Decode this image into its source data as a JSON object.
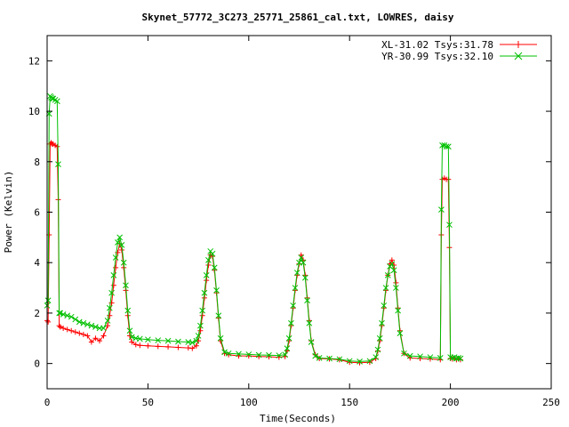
{
  "chart_data": {
    "type": "line",
    "title": "Skynet_57772_3C273_25771_25861_cal.txt, LOWRES, daisy",
    "xlabel": "Time(Seconds)",
    "ylabel": "Power (Kelvin)",
    "xlim": [
      0,
      250
    ],
    "ylim": [
      -1,
      13
    ],
    "x_ticks": [
      0,
      50,
      100,
      150,
      200,
      250
    ],
    "y_ticks": [
      0,
      2,
      4,
      6,
      8,
      10,
      12
    ],
    "x_tick_labels": [
      "0",
      "50",
      "100",
      "150",
      "200",
      "250"
    ],
    "y_tick_labels": [
      "0",
      "2",
      "4",
      "6",
      "8",
      "10",
      "12"
    ],
    "grid": false,
    "legend_position": "top-right",
    "series": [
      {
        "name": "XL-31.02 Tsys:31.78",
        "color": "#ff0000",
        "marker": "plus",
        "x": [
          0,
          0.5,
          1,
          1.5,
          2,
          2.5,
          3,
          4,
          5,
          5.5,
          6,
          6.5,
          8,
          10,
          12,
          14,
          16,
          18,
          20,
          22,
          24,
          26,
          28,
          30,
          31,
          32,
          33,
          34,
          35,
          36,
          37,
          38,
          39,
          40,
          41,
          42,
          44,
          46,
          50,
          55,
          60,
          65,
          70,
          72,
          74,
          75,
          76,
          77,
          78,
          79,
          80,
          81,
          82,
          83,
          84,
          85,
          86,
          88,
          90,
          95,
          100,
          105,
          110,
          115,
          118,
          119,
          120,
          121,
          122,
          123,
          124,
          125,
          126,
          127,
          128,
          129,
          130,
          131,
          133,
          135,
          140,
          145,
          150,
          155,
          160,
          163,
          164,
          165,
          166,
          167,
          168,
          169,
          170,
          171,
          172,
          173,
          174,
          175,
          177,
          180,
          185,
          190,
          195,
          195.5,
          196,
          197,
          198,
          199,
          199.5,
          200,
          201,
          202,
          203,
          204,
          205
        ],
        "y": [
          1.7,
          1.65,
          5.1,
          8.7,
          8.75,
          8.7,
          8.7,
          8.65,
          8.6,
          6.5,
          1.5,
          1.45,
          1.4,
          1.35,
          1.3,
          1.25,
          1.2,
          1.15,
          1.1,
          0.85,
          1.0,
          0.9,
          1.1,
          1.5,
          1.9,
          2.4,
          3.1,
          3.8,
          4.4,
          4.75,
          4.5,
          3.8,
          2.9,
          1.9,
          1.1,
          0.85,
          0.75,
          0.72,
          0.7,
          0.68,
          0.66,
          0.64,
          0.62,
          0.6,
          0.7,
          0.9,
          1.3,
          1.9,
          2.6,
          3.3,
          3.9,
          4.3,
          4.25,
          3.7,
          2.8,
          1.8,
          0.9,
          0.4,
          0.35,
          0.3,
          0.3,
          0.28,
          0.27,
          0.25,
          0.28,
          0.5,
          0.9,
          1.5,
          2.2,
          2.9,
          3.5,
          3.95,
          4.3,
          4.1,
          3.5,
          2.6,
          1.7,
          0.9,
          0.35,
          0.2,
          0.18,
          0.15,
          0.05,
          0.03,
          0.05,
          0.2,
          0.5,
          0.9,
          1.5,
          2.2,
          2.9,
          3.5,
          3.95,
          4.1,
          3.9,
          3.2,
          2.2,
          1.3,
          0.4,
          0.22,
          0.2,
          0.18,
          0.15,
          5.1,
          7.3,
          7.35,
          7.3,
          7.3,
          4.6,
          0.2,
          0.18,
          0.2,
          0.15,
          0.18,
          0.15
        ]
      },
      {
        "name": "YR-30.99 Tsys:32.10",
        "color": "#00c000",
        "marker": "cross",
        "x": [
          0,
          0.5,
          1,
          1.5,
          2,
          2.5,
          3,
          4,
          5,
          5.5,
          6,
          6.5,
          8,
          10,
          12,
          14,
          16,
          18,
          20,
          22,
          24,
          26,
          28,
          30,
          31,
          32,
          33,
          34,
          35,
          36,
          37,
          38,
          39,
          40,
          41,
          42,
          44,
          46,
          50,
          55,
          60,
          65,
          70,
          72,
          74,
          75,
          76,
          77,
          78,
          79,
          80,
          81,
          82,
          83,
          84,
          85,
          86,
          88,
          90,
          95,
          100,
          105,
          110,
          115,
          118,
          119,
          120,
          121,
          122,
          123,
          124,
          125,
          126,
          127,
          128,
          129,
          130,
          131,
          133,
          135,
          140,
          145,
          150,
          155,
          160,
          163,
          164,
          165,
          166,
          167,
          168,
          169,
          170,
          171,
          172,
          173,
          174,
          175,
          177,
          180,
          185,
          190,
          195,
          195.5,
          196,
          197,
          198,
          199,
          199.5,
          200,
          201,
          202,
          203,
          204,
          205
        ],
        "y": [
          2.3,
          2.5,
          9.9,
          10.6,
          10.55,
          10.5,
          10.5,
          10.45,
          10.4,
          7.9,
          2.0,
          2.0,
          1.95,
          1.9,
          1.85,
          1.75,
          1.65,
          1.6,
          1.55,
          1.5,
          1.45,
          1.4,
          1.4,
          1.7,
          2.2,
          2.8,
          3.5,
          4.2,
          4.8,
          5.0,
          4.7,
          4.0,
          3.1,
          2.1,
          1.3,
          1.05,
          1.0,
          0.98,
          0.95,
          0.92,
          0.9,
          0.87,
          0.85,
          0.83,
          0.9,
          1.1,
          1.5,
          2.1,
          2.8,
          3.5,
          4.1,
          4.45,
          4.35,
          3.8,
          2.9,
          1.9,
          1.0,
          0.45,
          0.4,
          0.38,
          0.36,
          0.34,
          0.33,
          0.32,
          0.35,
          0.6,
          1.0,
          1.6,
          2.3,
          3.0,
          3.6,
          4.0,
          4.2,
          4.0,
          3.4,
          2.5,
          1.6,
          0.85,
          0.3,
          0.22,
          0.2,
          0.17,
          0.1,
          0.08,
          0.1,
          0.25,
          0.55,
          1.0,
          1.6,
          2.3,
          3.0,
          3.5,
          3.85,
          3.95,
          3.7,
          3.0,
          2.1,
          1.2,
          0.4,
          0.3,
          0.28,
          0.25,
          0.22,
          6.1,
          8.65,
          8.65,
          8.6,
          8.6,
          5.5,
          0.25,
          0.22,
          0.25,
          0.2,
          0.22,
          0.2
        ]
      }
    ]
  }
}
